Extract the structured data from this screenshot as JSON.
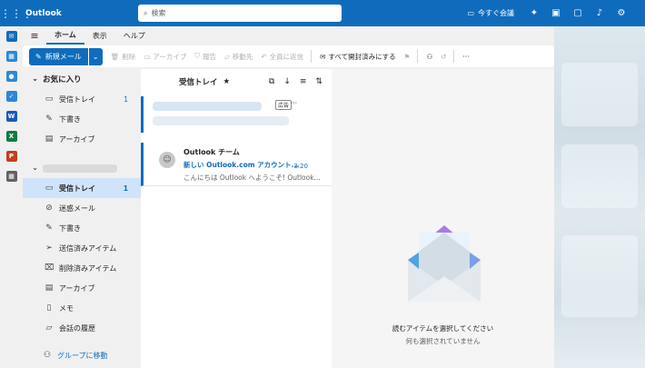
{
  "app": {
    "name": "Outlook"
  },
  "search": {
    "placeholder": "検索"
  },
  "topbar": {
    "meet_now": "今すぐ会議"
  },
  "tabs": [
    {
      "label": "ホーム",
      "active": true
    },
    {
      "label": "表示",
      "active": false
    },
    {
      "label": "ヘルプ",
      "active": false
    }
  ],
  "ribbon": {
    "new_mail": "新規メール",
    "delete": "削除",
    "archive": "アーカイブ",
    "report": "報告",
    "move_to": "移動先",
    "reply_all": "全員に返信",
    "mark_all_read": "すべて開封済みにする"
  },
  "folders": {
    "favorites_header": "お気に入り",
    "favorites": [
      {
        "label": "受信トレイ",
        "count": "1",
        "icon": "inbox-icon"
      },
      {
        "label": "下書き",
        "count": "",
        "icon": "pencil-icon"
      },
      {
        "label": "アーカイブ",
        "count": "",
        "icon": "archive-icon"
      }
    ],
    "account": [
      {
        "label": "受信トレイ",
        "count": "1",
        "icon": "inbox-icon",
        "selected": true
      },
      {
        "label": "迷惑メール",
        "count": "",
        "icon": "junk-icon"
      },
      {
        "label": "下書き",
        "count": "",
        "icon": "pencil-icon"
      },
      {
        "label": "送信済みアイテム",
        "count": "",
        "icon": "send-icon"
      },
      {
        "label": "削除済みアイテム",
        "count": "",
        "icon": "trash-icon"
      },
      {
        "label": "アーカイブ",
        "count": "",
        "icon": "archive-icon"
      },
      {
        "label": "メモ",
        "count": "",
        "icon": "note-icon"
      },
      {
        "label": "会話の履歴",
        "count": "",
        "icon": "folder-icon"
      }
    ],
    "go_to_groups": "グループに移動"
  },
  "message_list": {
    "title": "受信トレイ",
    "ad_tag": "広告",
    "messages": [
      {
        "from": "Outlook チーム",
        "subject": "新しい Outlook.com アカウント...",
        "time": "3:20",
        "preview": "こんにちは Outlook へようこそ! Outlook..."
      }
    ]
  },
  "reading_pane": {
    "empty_title": "読むアイテムを選択してください",
    "empty_subtitle": "何も選択されていません"
  },
  "colors": {
    "brand": "#0f6cbd",
    "selected": "#cfe4fa"
  }
}
